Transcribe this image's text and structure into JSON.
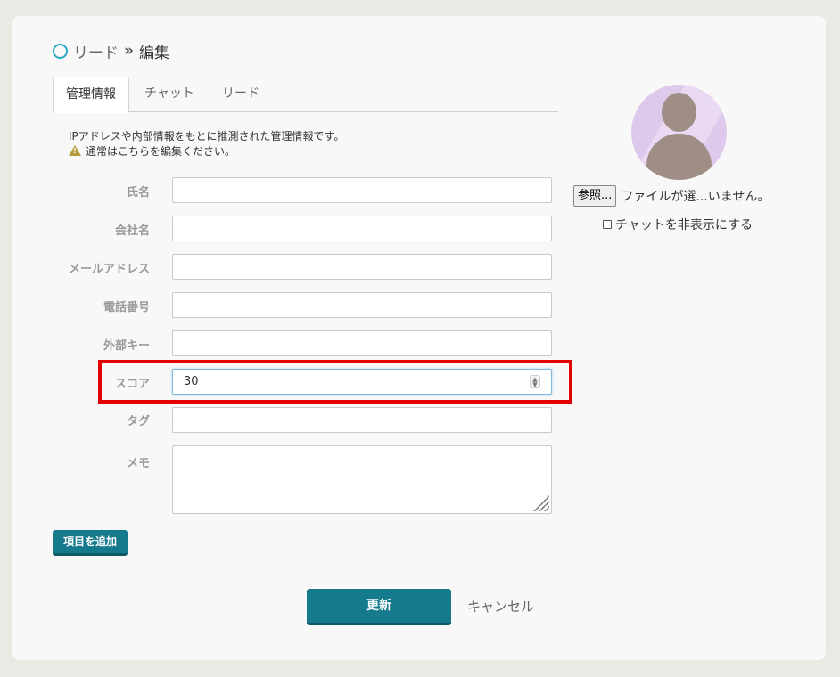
{
  "breadcrumb": {
    "parent": "リード",
    "separator": "»",
    "current": "編集"
  },
  "tabs": [
    {
      "label": "管理情報",
      "active": true
    },
    {
      "label": "チャット",
      "active": false
    },
    {
      "label": "リード",
      "active": false
    }
  ],
  "info": {
    "line1": "IPアドレスや内部情報をもとに推測された管理情報です。",
    "line2": "通常はこちらを編集ください。"
  },
  "form": {
    "name_label": "氏名",
    "name_value": "",
    "company_label": "会社名",
    "company_value": "",
    "email_label": "メールアドレス",
    "email_value": "",
    "phone_label": "電話番号",
    "phone_value": "",
    "external_key_label": "外部キー",
    "external_key_value": "",
    "score_label": "スコア",
    "score_value": "30",
    "tag_label": "タグ",
    "tag_value": "",
    "memo_label": "メモ",
    "memo_value": ""
  },
  "buttons": {
    "add_item": "項目を追加",
    "update": "更新",
    "cancel": "キャンセル"
  },
  "avatar": {
    "browse_label": "参照...",
    "file_status": "ファイルが選...いません。",
    "hide_chat_label": "チャットを非表示にする",
    "hide_chat_checked": false
  },
  "colors": {
    "accent": "#157a8c",
    "highlight": "#e30000",
    "circle": "#2aa8c9"
  }
}
